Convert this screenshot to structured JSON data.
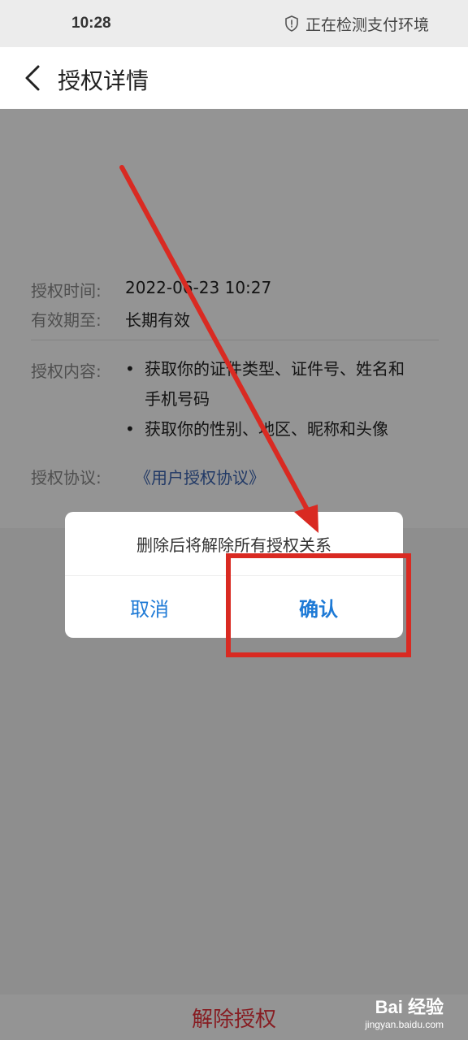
{
  "status_bar": {
    "time": "10:28",
    "status_text": "正在检测支付环境",
    "icon": "shield-icon"
  },
  "header": {
    "title": "授权详情",
    "back_icon": "chevron-left-icon"
  },
  "details": {
    "auth_time_label": "授权时间:",
    "auth_time_value": "2022-06-23 10:27",
    "valid_until_label": "有效期至:",
    "valid_until_value": "长期有效",
    "content_label": "授权内容:",
    "content_items": [
      "获取你的证件类型、证件号、姓名和",
      "手机号码",
      "获取你的性别、地区、昵称和头像"
    ],
    "agreement_label": "授权协议:",
    "agreement_link": "《用户授权协议》"
  },
  "bottom": {
    "revoke_label": "解除授权"
  },
  "dialog": {
    "message": "删除后将解除所有授权关系",
    "cancel_label": "取消",
    "confirm_label": "确认"
  },
  "watermark": {
    "logo": "Bai  经验",
    "site": "jingyan.baidu.com"
  },
  "colors": {
    "accent": "#1e7ad6",
    "danger": "#e8323c",
    "annotation": "#d92a22",
    "link": "#3a63b0"
  }
}
